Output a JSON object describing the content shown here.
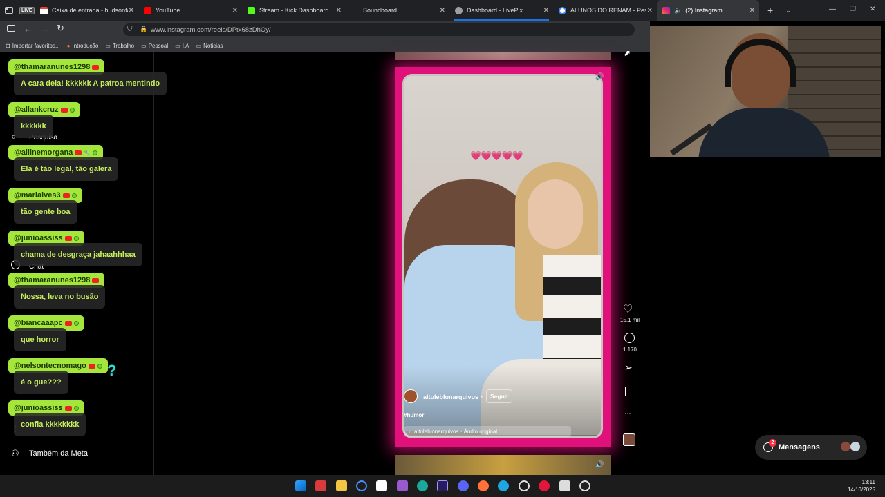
{
  "tabs": [
    {
      "label": "",
      "badge": "LIVE",
      "active": false
    },
    {
      "label": "Caixa de entrada - hudsonfabio",
      "active": false,
      "color": "#ea4335"
    },
    {
      "label": "YouTube",
      "active": false,
      "color": "#ff0000"
    },
    {
      "label": "Stream - Kick Dashboard",
      "active": false,
      "color": "#53fc18"
    },
    {
      "label": "Soundboard",
      "active": false,
      "color": "#888888"
    },
    {
      "label": "Dashboard - LivePix",
      "active": false,
      "color": "#9aa0a6"
    },
    {
      "label": "ALUNOS DO RENAM - Pesquisa",
      "active": false,
      "color": "#4285f4"
    },
    {
      "label": "(2) Instagram",
      "active": true,
      "color": "#e1306c"
    }
  ],
  "address": {
    "url": "www.instagram.com/reels/DPtx68zDhOy/"
  },
  "bookmarks": [
    {
      "label": "Importar favoritos..."
    },
    {
      "label": "Introdução"
    },
    {
      "label": "Trabalho"
    },
    {
      "label": "Pessoal"
    },
    {
      "label": "I.A"
    },
    {
      "label": "Noticias"
    }
  ],
  "sidebar": {
    "partial_items": [
      "Pesquisa",
      "Chat"
    ],
    "bottom_item": "Também da Meta"
  },
  "chat": [
    {
      "user": "@thamaranunes1298",
      "message": "A cara dela! kkkkkk A patroa mentindo"
    },
    {
      "user": "@allankcruz",
      "message": "kkkkkk"
    },
    {
      "user": "@allinemorgana",
      "message": "Ela é tão legal, tão galera"
    },
    {
      "user": "@marialves3",
      "message": "tão gente boa"
    },
    {
      "user": "@junioassiss",
      "message": "chama de desgraça jahaahhhaa"
    },
    {
      "user": "@thamaranunes1298",
      "message": "Nossa, leva no busão"
    },
    {
      "user": "@biancaaapc",
      "message": "que horror"
    },
    {
      "user": "@nelsontecnomago",
      "message": "é o gue???"
    },
    {
      "user": "@junioassiss",
      "message": "confia kkkkkkkk"
    }
  ],
  "reel": {
    "overlay_text": "💗💗💗💗💗",
    "author": "altoleblonarquivos",
    "follow_label": "Seguir",
    "separator": "•",
    "hashtag": "#humor",
    "audio": "altoleblonarquivos · Áudio original",
    "likes": "15,1 mil",
    "comments": "1.170"
  },
  "messages": {
    "label": "Mensagens",
    "badge": "2"
  },
  "clock": {
    "time": "13:11",
    "date": "14/10/2025"
  },
  "colors": {
    "accent": "#e0117a",
    "chat_user_bg": "#a5e63c",
    "chat_text": "#c6f05a"
  }
}
